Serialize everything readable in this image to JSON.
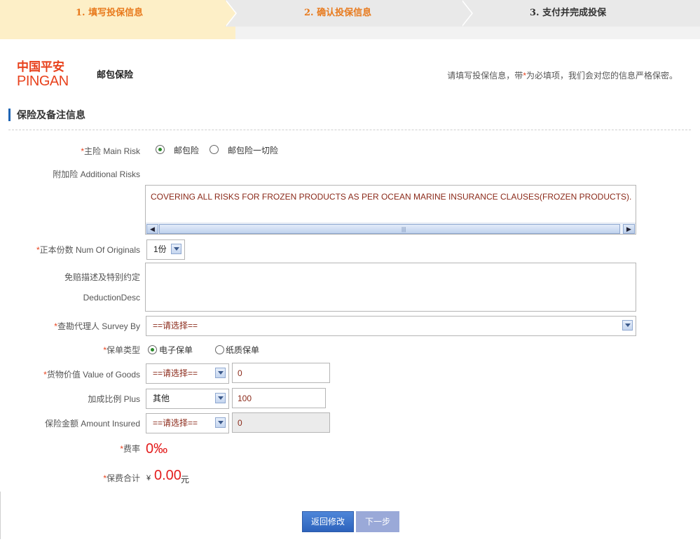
{
  "steps": [
    {
      "label": "1. 填写投保信息"
    },
    {
      "label": "2. 确认投保信息"
    },
    {
      "label": "3. 支付并完成投保"
    }
  ],
  "header": {
    "logo_cn": "中国平安",
    "logo_en": "PINGAN",
    "product_name": "邮包保险",
    "notice_prefix": "请填写投保信息，带",
    "notice_star": "*",
    "notice_suffix": "为必填项，我们会对您的信息严格保密。"
  },
  "section": {
    "title": "保险及备注信息"
  },
  "form": {
    "required_mark": "*",
    "main_risk": {
      "label": "主险 Main Risk",
      "options": [
        "邮包险",
        "邮包险一切险"
      ],
      "selected": "邮包险"
    },
    "additional_risks": {
      "label": "附加险 Additional Risks",
      "value": "COVERING ALL RISKS FOR FROZEN PRODUCTS  AS PER OCEAN MARINE INSURANCE CLAUSES(FROZEN PRODUCTS)."
    },
    "num_originals": {
      "label": "正本份数 Num Of Originals",
      "value": "1份"
    },
    "deduction": {
      "label_cn": "免赔描述及特别约定",
      "label_en": "DeductionDesc",
      "value": ""
    },
    "survey_by": {
      "label": "查勘代理人 Survey By",
      "value": "==请选择=="
    },
    "policy_type": {
      "label": "保单类型",
      "options": [
        "电子保单",
        "纸质保单"
      ],
      "selected": "电子保单"
    },
    "value_of_goods": {
      "label": "货物价值 Value of Goods",
      "select": "==请选择==",
      "value": "0"
    },
    "plus": {
      "label": "加成比例 Plus",
      "select": "其他",
      "value": "100"
    },
    "amount_insured": {
      "label": "保险金额 Amount Insured",
      "select": "==请选择==",
      "value": "0"
    },
    "rate": {
      "label": "费率",
      "value": "0‰"
    },
    "premium": {
      "label": "保费合计",
      "currency": "¥",
      "value": "0.00",
      "unit": "元"
    }
  },
  "buttons": {
    "back": "返回修改",
    "next": "下一步"
  },
  "icons": {
    "scroll_left": "◀",
    "scroll_right": "▶",
    "scroll_grip": "|||"
  },
  "colors": {
    "accent": "#e87a1d",
    "required": "#e8421d",
    "primary_button": "#2d63bd",
    "amount": "#e31c1c"
  }
}
